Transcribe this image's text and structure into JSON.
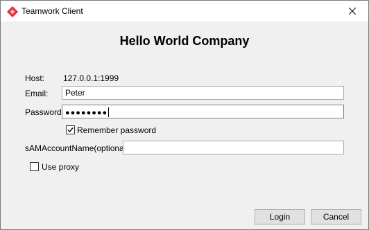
{
  "window": {
    "title": "Teamwork Client",
    "close_symbol": "✕"
  },
  "heading": "Hello World Company",
  "form": {
    "host_label": "Host:",
    "host_value": "127.0.0.1:1999",
    "email_label": "Email:",
    "email_value": "Peter",
    "password_label": "Password:",
    "password_masked": "●●●●●●●●",
    "remember_label": "Remember password",
    "remember_checked": true,
    "samaccount_label": "sAMAccountName(optional):",
    "samaccount_value": "",
    "proxy_label": "Use proxy",
    "proxy_checked": false
  },
  "buttons": {
    "login": "Login",
    "cancel": "Cancel"
  },
  "icons": {
    "app": "visual-paradigm-logo-icon",
    "close": "close-icon",
    "check": "checkmark-icon"
  },
  "colors": {
    "brand": "#d9262c",
    "window_bg": "#f0f0f0",
    "button_bg": "#e1e1e1"
  }
}
